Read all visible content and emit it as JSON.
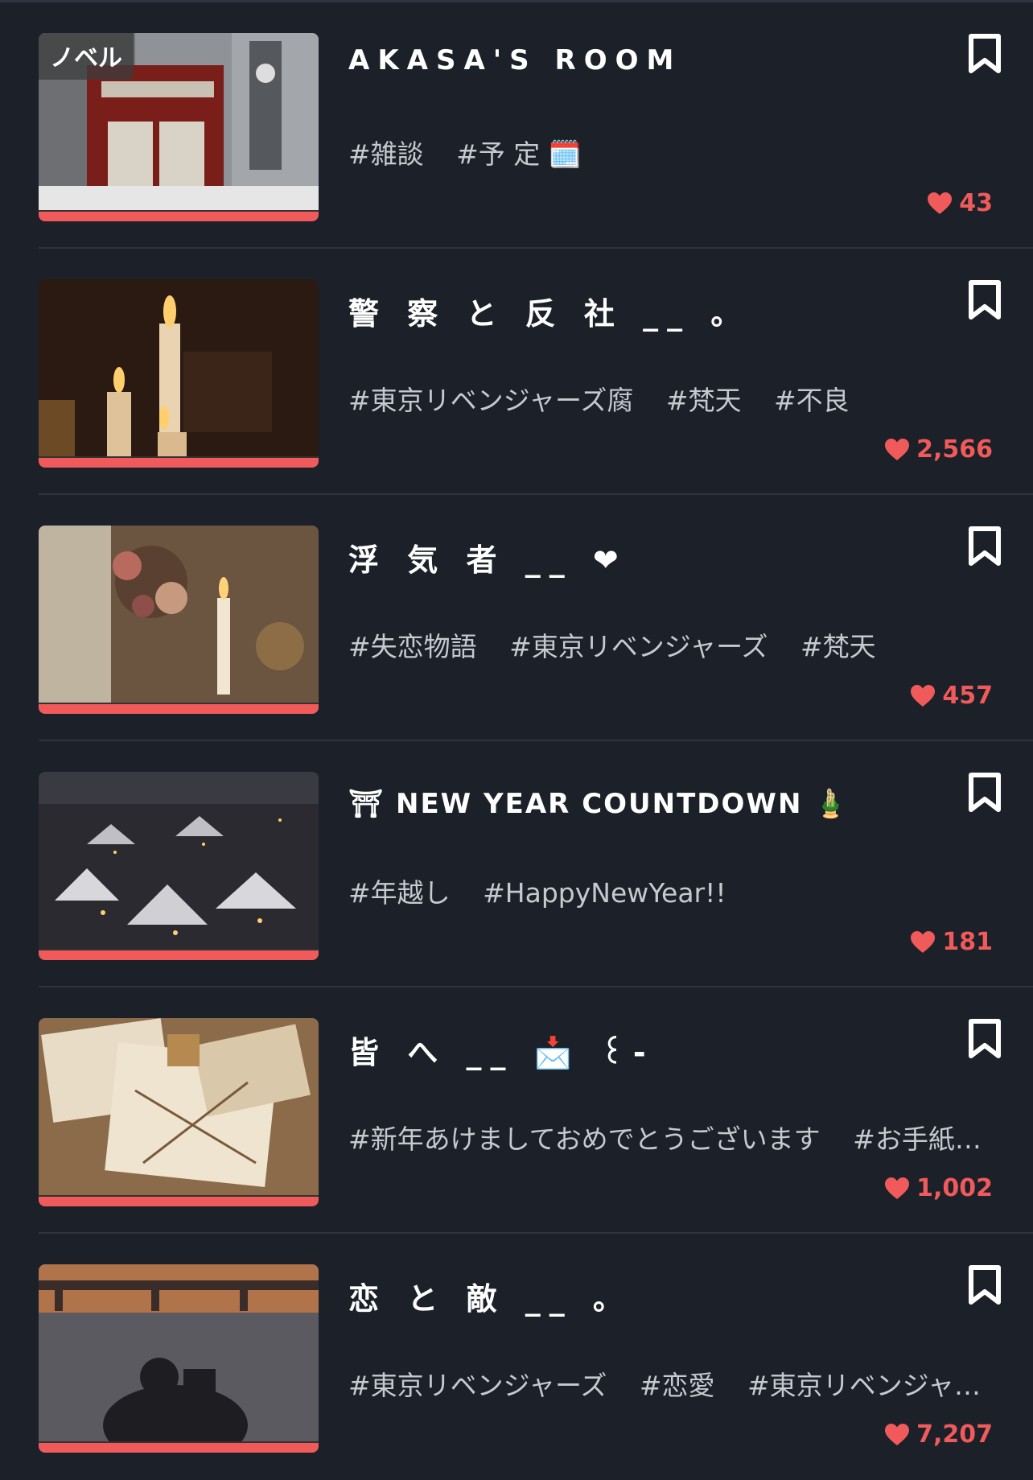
{
  "colors": {
    "background": "#1b2029",
    "accent": "#f05a5a",
    "tag_text": "#c6c9ce",
    "divider": "#2e343f"
  },
  "items": [
    {
      "badge": "ノベル",
      "title": "AKASA'S ROOM",
      "tags": [
        "#雑談",
        "#予 定 🗓️"
      ],
      "likes": "43",
      "thumb_icon": "telephone-booth-image"
    },
    {
      "badge": "",
      "title": "警 察 と 反 社 __ 。",
      "tags": [
        "#東京リベンジャーズ腐",
        "#梵天",
        "#不良"
      ],
      "likes": "2,566",
      "thumb_icon": "candles-image"
    },
    {
      "badge": "",
      "title": "浮 気 者 __ ❤",
      "tags": [
        "#失恋物語",
        "#東京リベンジャーズ",
        "#梵天"
      ],
      "likes": "457",
      "thumb_icon": "flowers-candle-image"
    },
    {
      "badge": "",
      "title": "⛩ NEW YEAR  COUNTDOWN 🎍",
      "tags": [
        "#年越し",
        "#HappyNewYear!!"
      ],
      "likes": "181",
      "thumb_icon": "snow-village-image"
    },
    {
      "badge": "",
      "title": "皆 へ __ 📩 ꒰-",
      "tags": [
        "#新年あけましておめでとうございます",
        "#お手紙💌"
      ],
      "likes": "1,002",
      "thumb_icon": "books-letters-image"
    },
    {
      "badge": "",
      "title": "恋 と 敵 __ 。",
      "tags": [
        "#東京リベンジャーズ",
        "#恋愛",
        "#東京リベンジャ…"
      ],
      "likes": "7,207",
      "thumb_icon": "sunset-pier-image"
    }
  ]
}
